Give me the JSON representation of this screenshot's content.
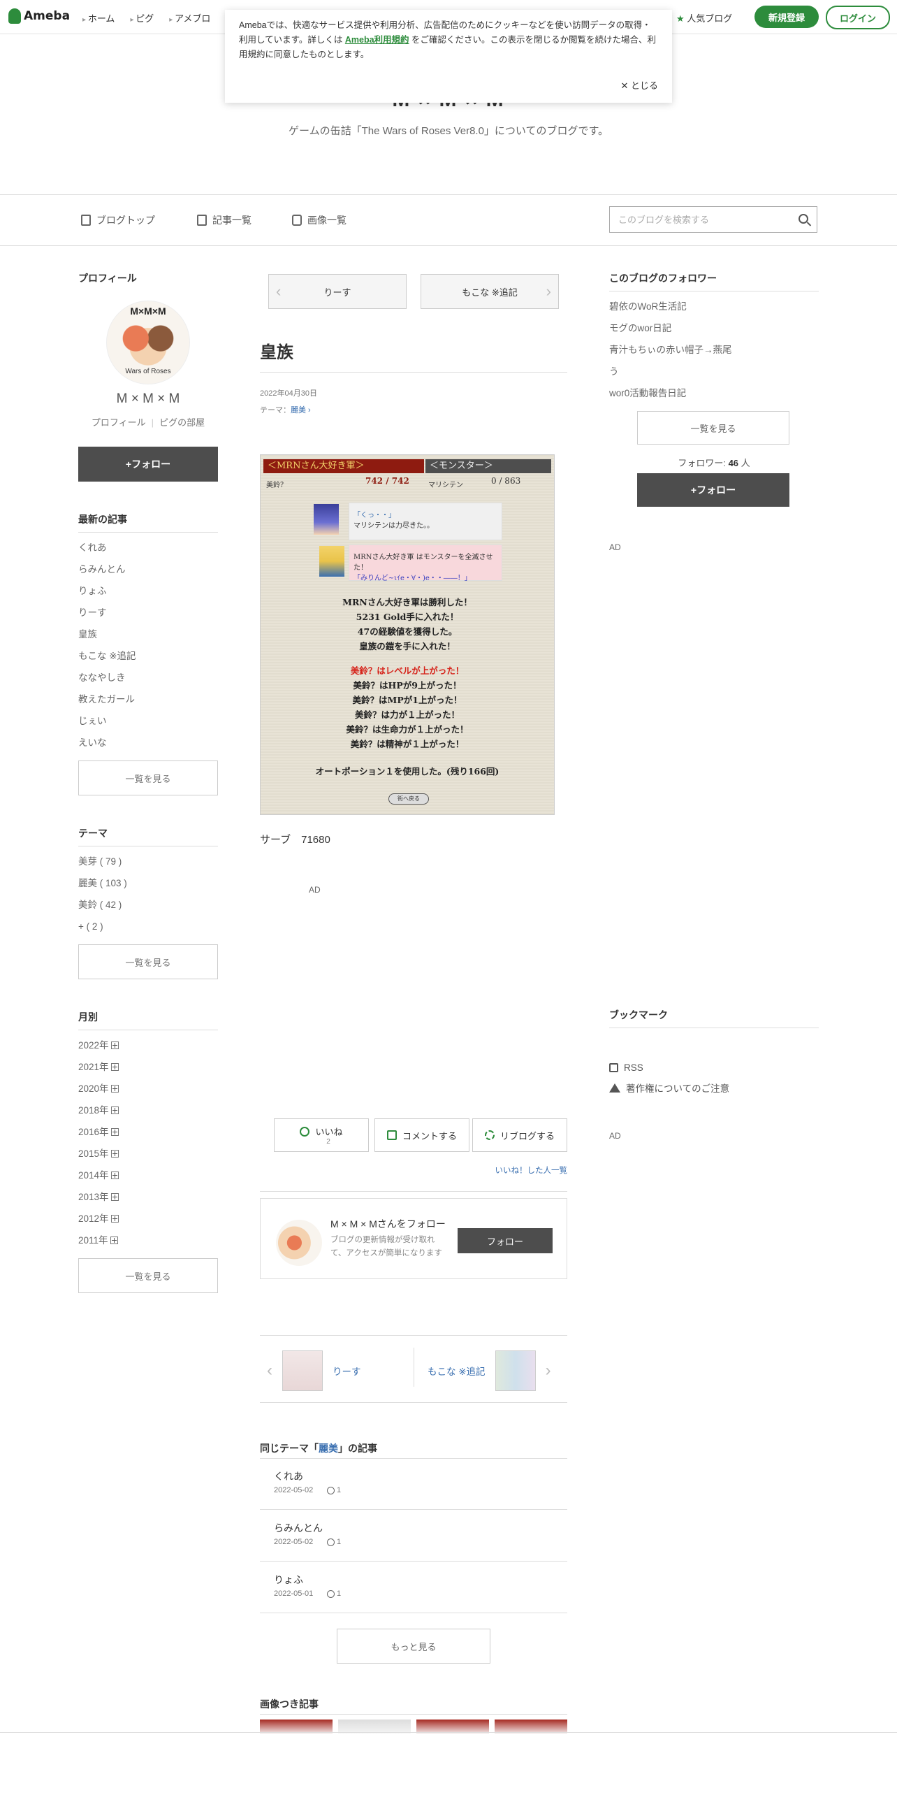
{
  "topbar": {
    "logo_text": "Ameba",
    "nav": [
      "ホーム",
      "ピグ",
      "アメブロ"
    ],
    "popular": "人気ブログ",
    "signup": "新規登録",
    "login": "ログイン"
  },
  "cookie": {
    "text_before": "Amebaでは、快適なサービス提供や利用分析、広告配信のためにクッキーなどを使い訪問データの取得・利用しています。詳しくは ",
    "link": "Ameba利用規約",
    "text_after": " をご確認ください。この表示を閉じるか閲覧を続けた場合、利用規約に同意したものとします。",
    "close": "✕ とじる"
  },
  "header": {
    "title": "M × M × M",
    "description": "ゲームの缶詰「The Wars of Roses Ver8.0」についてのブログです。"
  },
  "blognav": {
    "top": "ブログトップ",
    "articles": "記事一覧",
    "images": "画像一覧",
    "search_placeholder": "このブログを検索する"
  },
  "profile": {
    "section": "プロフィール",
    "avatar_title": "M×M×M",
    "avatar_caption": "Wars of Roses",
    "name": "M × M × M",
    "link_profile": "プロフィール",
    "link_room": "ピグの部屋",
    "follow": "+フォロー"
  },
  "recent": {
    "section": "最新の記事",
    "items": [
      "くれあ",
      "らみんとん",
      "りょふ",
      "りーす",
      "皇族",
      "もこな ※追記",
      "ななやしき",
      "教えたガール",
      "じぇい",
      "えいな"
    ],
    "more": "一覧を見る"
  },
  "theme": {
    "section": "テーマ",
    "items": [
      "美芽 ( 79 )",
      "麗美 ( 103 )",
      "美鈴 ( 42 )",
      "+ ( 2 )"
    ],
    "more": "一覧を見る"
  },
  "monthly": {
    "section": "月別",
    "items": [
      "2022年",
      "2021年",
      "2020年",
      "2018年",
      "2016年",
      "2015年",
      "2014年",
      "2013年",
      "2012年",
      "2011年"
    ],
    "more": "一覧を見る"
  },
  "article": {
    "prev": "りーす",
    "next": "もこな ※追記",
    "title": "皇族",
    "date": "2022年04月30日",
    "theme_label": "テーマ：",
    "theme": "麗美",
    "caption": "サーブ　71680",
    "ad": "AD"
  },
  "game": {
    "party": "＜MRNさん大好き軍＞",
    "enemy": "＜モンスター＞",
    "member": "美鈴？",
    "hp": "742 / 742",
    "enemy_name": "マリシテン",
    "enemy_hp": "0 / 863",
    "box1_line1": "「くっ・・」",
    "box1_line2": "マリシテンは力尽きた。。",
    "box2_line1": "MRNさん大好き軍 はモンスターを全滅させた！",
    "box2_line2": "「みりんど~ιｲe・∀・)e・・――！」",
    "lines": [
      "MRNさん大好き軍は勝利した！",
      "5231 Gold手に入れた！",
      "47の経験値を獲得した。",
      "皇族の鎧を手に入れた！"
    ],
    "levelup": "美鈴？はレベルが上がった！",
    "stats": [
      "美鈴？はHPが9上がった！",
      "美鈴？はMPが1上がった！",
      "美鈴？は力が１上がった！",
      "美鈴？は生命力が１上がった！",
      "美鈴？は精神が１上がった！"
    ],
    "potion": "オートポーション１を使用した。(残り166回)",
    "back": "街へ戻る"
  },
  "reactions": {
    "like": "いいね",
    "like_count": "2",
    "comment": "コメントする",
    "reblog": "リブログする",
    "liked_by": "いいね！した人一覧"
  },
  "follow_card": {
    "name": "M × M × Mさんをフォロー",
    "desc": "ブログの更新情報が受け取れて、アクセスが簡単になります",
    "button": "フォロー"
  },
  "next_prev": {
    "prev": "りーす",
    "next": "もこな ※追記"
  },
  "same_theme": {
    "title_pre": "同じテーマ「",
    "theme": "麗美",
    "title_post": "」の記事",
    "items": [
      {
        "title": "くれあ",
        "date": "2022-05-02",
        "likes": "1"
      },
      {
        "title": "らみんとん",
        "date": "2022-05-02",
        "likes": "1"
      },
      {
        "title": "りょふ",
        "date": "2022-05-01",
        "likes": "1"
      }
    ],
    "more": "もっと見る"
  },
  "image_articles": {
    "title": "画像つき記事"
  },
  "followers": {
    "section": "このブログのフォロワー",
    "items": [
      "碧依のWoR生活記",
      "モグのwor日記",
      "青汁もちぃの赤い帽子→燕尾",
      "う",
      "wor0活動報告日記"
    ],
    "more": "一覧を見る",
    "count_label": "フォロワー: ",
    "count": "46",
    "count_unit": " 人",
    "follow": "+フォロー"
  },
  "right_ad": "AD",
  "bookmark": {
    "section": "ブックマーク",
    "rss": "RSS",
    "copyright": "著作権についてのご注意"
  },
  "right_ad2": "AD"
}
